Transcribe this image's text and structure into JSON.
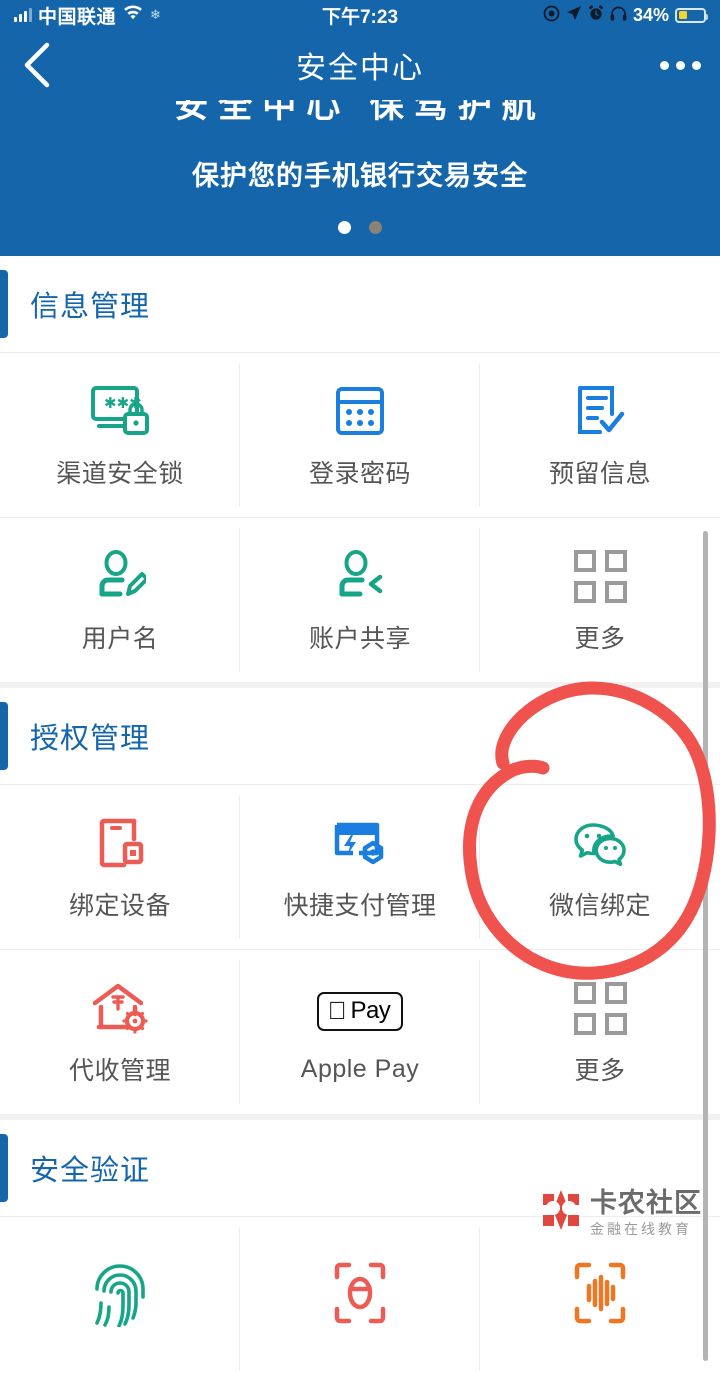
{
  "status_bar": {
    "carrier": "中国联通",
    "time": "下午7:23",
    "battery_percent": "34%",
    "icons": [
      "signal-bars-icon",
      "wifi-icon",
      "snowflake-icon",
      "screen-record-icon",
      "location-arrow-icon",
      "alarm-clock-icon",
      "headphones-icon",
      "battery-icon"
    ]
  },
  "nav": {
    "back_icon": "chevron-left-icon",
    "title": "安全中心",
    "more_icon": "more-dots-icon"
  },
  "banner": {
    "headline": "安全中心 保驾护航",
    "subtitle": "保护您的手机银行交易安全",
    "dots": [
      "active",
      "inactive"
    ]
  },
  "sections": [
    {
      "title": "信息管理",
      "items": [
        {
          "label": "渠道安全锁",
          "icon": "screen-password-lock-icon",
          "color": "#17a589"
        },
        {
          "label": "登录密码",
          "icon": "keypad-icon",
          "color": "#1a7ee0"
        },
        {
          "label": "预留信息",
          "icon": "document-check-icon",
          "color": "#1a7ee0"
        },
        {
          "label": "用户名",
          "icon": "user-edit-icon",
          "color": "#17a589"
        },
        {
          "label": "账户共享",
          "icon": "user-share-icon",
          "color": "#17a589"
        },
        {
          "label": "更多",
          "icon": "grid-more-icon",
          "color": "#9a9a9a"
        }
      ]
    },
    {
      "title": "授权管理",
      "items": [
        {
          "label": "绑定设备",
          "icon": "device-bind-icon",
          "color": "#ed5b55"
        },
        {
          "label": "快捷支付管理",
          "icon": "quick-pay-card-icon",
          "color": "#1a7ee0"
        },
        {
          "label": "微信绑定",
          "icon": "wechat-icon",
          "color": "#17a589"
        },
        {
          "label": "代收管理",
          "icon": "house-payment-gear-icon",
          "color": "#ed5b55"
        },
        {
          "label": "Apple Pay",
          "icon": "apple-pay-icon",
          "color": "#000000"
        },
        {
          "label": "更多",
          "icon": "grid-more-icon",
          "color": "#9a9a9a"
        }
      ]
    },
    {
      "title": "安全验证",
      "items": [
        {
          "label": "",
          "icon": "fingerprint-icon",
          "color": "#17a589"
        },
        {
          "label": "",
          "icon": "face-scan-icon",
          "color": "#ed5b55"
        },
        {
          "label": "",
          "icon": "voiceprint-icon",
          "color": "#ef7622"
        }
      ]
    }
  ],
  "annotation": {
    "type": "hand-drawn-circle",
    "color": "#f0524d",
    "targets": "微信绑定"
  },
  "watermark": {
    "title": "卡农社区",
    "subtitle": "金融在线教育",
    "logo_color": "#e0483f"
  },
  "colors": {
    "brand_blue": "#1565ab",
    "icon_blue": "#1a7ee0",
    "icon_teal": "#17a589",
    "icon_red": "#ed5b55",
    "icon_orange": "#ef7622",
    "icon_gray": "#9a9a9a",
    "label_gray": "#555555",
    "page_bg": "#f2f2f2"
  }
}
